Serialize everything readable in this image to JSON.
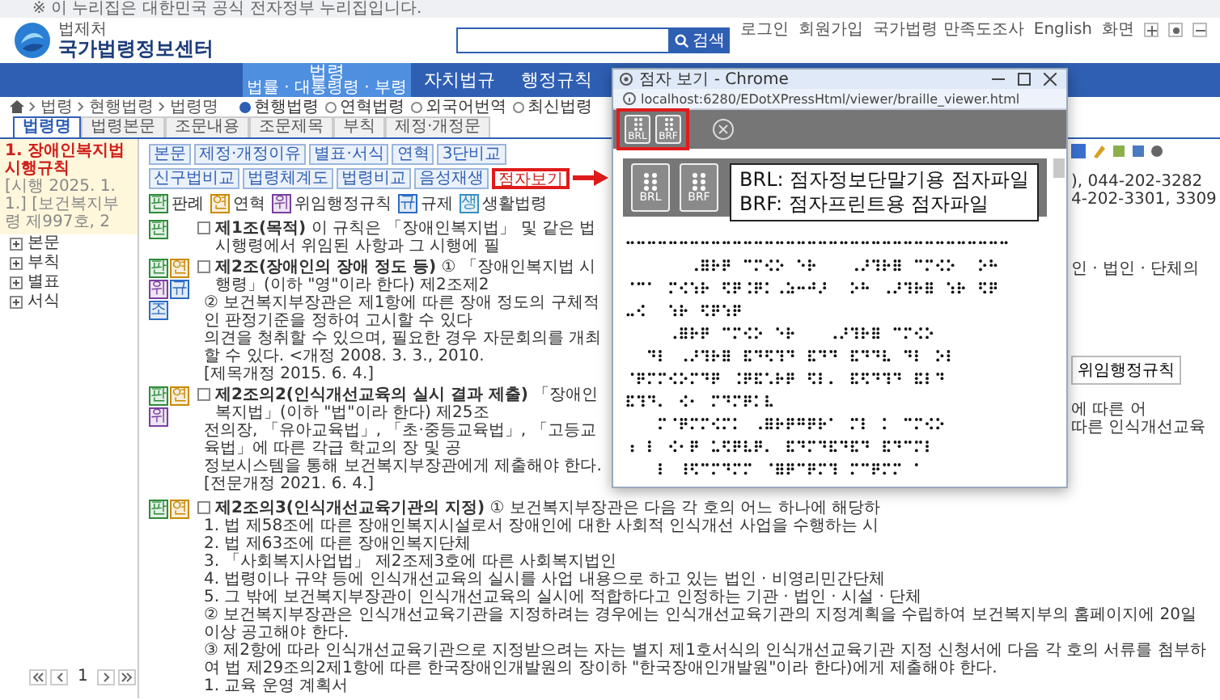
{
  "notice_bar": {
    "text": "※ 이 누리집은 대한민국 공식 전자정부 누리집입니다."
  },
  "header": {
    "logo": {
      "org": "법제처",
      "name": "국가법령정보센터"
    },
    "links": [
      "로그인",
      "회원가입",
      "국가법령 만족도조사",
      "English"
    ],
    "zoom_label": "화면",
    "search": {
      "button": "검색"
    }
  },
  "nav": [
    {
      "label": "법령",
      "sub": "법률 · 대통령령 · 부령",
      "selected": true
    },
    {
      "label": "자치법규",
      "selected": false
    },
    {
      "label": "행정규칙",
      "selected": false
    }
  ],
  "breadcrumb": [
    "법령",
    "현행법령",
    "법령명"
  ],
  "scope_options": [
    {
      "label": "현행법령",
      "selected": true
    },
    {
      "label": "연혁법령",
      "selected": false
    },
    {
      "label": "외국어번역",
      "selected": false
    },
    {
      "label": "최신법령",
      "selected": false
    }
  ],
  "tabs": [
    {
      "label": "법령명",
      "selected": true
    },
    {
      "label": "법령본문",
      "selected": false
    },
    {
      "label": "조문내용",
      "selected": false
    },
    {
      "label": "조문제목",
      "selected": false
    },
    {
      "label": "부칙",
      "selected": false
    },
    {
      "label": "제정·개정문",
      "selected": false
    }
  ],
  "sidebar": {
    "items": [
      {
        "title": "1. 장애인복지법 시행규칙",
        "detail": "[시행 2025. 1. 1.] [보건복지부령 제997호, 2",
        "selected": true
      }
    ],
    "tree": [
      "본문",
      "부칙",
      "별표",
      "서식"
    ],
    "pager": {
      "page": "1"
    }
  },
  "toolbar": [
    {
      "label": "본문",
      "highlighted": false
    },
    {
      "label": "제정·개정이유",
      "highlighted": false
    },
    {
      "label": "별표·서식",
      "highlighted": false
    },
    {
      "label": "연혁",
      "highlighted": false
    },
    {
      "label": "3단비교",
      "highlighted": false
    },
    {
      "label": "신구법비교",
      "highlighted": false
    },
    {
      "label": "법령체계도",
      "highlighted": false
    },
    {
      "label": "법령비교",
      "highlighted": false
    },
    {
      "label": "음성재생",
      "highlighted": false
    },
    {
      "label": "점자보기",
      "highlighted": true
    }
  ],
  "legend": [
    {
      "tag": "판",
      "label": "판례",
      "color": "#2e8b3a"
    },
    {
      "tag": "연",
      "label": "연혁",
      "color": "#c98a00"
    },
    {
      "tag": "위",
      "label": "위임행정규칙",
      "color": "#7a3fa0"
    },
    {
      "tag": "규",
      "label": "규제",
      "color": "#2a6cc4"
    },
    {
      "tag": "생",
      "label": "생활법령",
      "color": "#3a8fc0"
    }
  ],
  "articles": [
    {
      "tags": [
        {
          "label": "판",
          "color": "#2e8b3a"
        }
      ],
      "checked": false,
      "lines": [
        "**제1조(목적)** 이 규칙은 「장애인복지법」 및 같은 법 시행령에서 위임된 사항과 그 시행에 필"
      ]
    },
    {
      "tags": [
        {
          "label": "판",
          "color": "#2e8b3a"
        },
        {
          "label": "연",
          "color": "#c98a00"
        },
        {
          "label": "위",
          "color": "#7a3fa0"
        },
        {
          "label": "규",
          "color": "#2a6cc4"
        },
        {
          "label": "조",
          "color": "#2a6cc4"
        }
      ],
      "checked": false,
      "lines": [
        "**제2조(장애인의 장애 정도 등)** ① 「장애인복지법 시행령」(이하 \"영\"이라 한다) 제2조제2",
        "② 보건복지부장관은 제1항에 따른 장애 정도의 구체적인 판정기준을 정하여 고시할 수 있다",
        "의견을 청취할 수 있으며, 필요한 경우 자문회의를 개최할 수 있다. <개정 2008. 3. 3., 2010.",
        "[제목개정 2015. 6. 4.]"
      ]
    },
    {
      "tags": [
        {
          "label": "판",
          "color": "#2e8b3a"
        },
        {
          "label": "연",
          "color": "#c98a00"
        },
        {
          "label": "위",
          "color": "#7a3fa0"
        }
      ],
      "checked": false,
      "lines": [
        "**제2조의2(인식개선교육의 실시 결과 제출)** 「장애인복지법」(이하 \"법\"이라 한다) 제25조",
        "전의장, 「유아교육법」, 「초·중등교육법」, 「고등교육법」에 따른 각급 학교의 장 및 공",
        "정보시스템을 통해 보건복지부장관에게 제출해야 한다.",
        "[전문개정 2021. 6. 4.]"
      ]
    }
  ],
  "lower_article": {
    "tags": [
      {
        "label": "판",
        "color": "#2e8b3a"
      },
      {
        "label": "연",
        "color": "#c98a00"
      }
    ],
    "checked": false,
    "lines": [
      "**제2조의3(인식개선교육기관의 지정)** ① 보건복지부장관은 다음 각 호의 어느 하나에 해당하",
      "1. 법 제58조에 따른 장애인복지시설로서 장애인에 대한 사회적 인식개선 사업을 수행하는 시",
      "2. 법 제63조에 따른 장애인복지단체",
      "3. 「사회복지사업법」 제2조제3호에 따른 사회복지법인",
      "4. 법령이나 규약 등에 인식개선교육의 실시를 사업 내용으로 하고 있는 법인 · 비영리민간단체",
      "5. 그 밖에 보건복지부장관이 인식개선교육의 실시에 적합하다고 인정하는 기관 · 법인 · 시설 · 단체",
      "② 보건복지부장관은 인식개선교육기관을 지정하려는 경우에는 인식개선교육기관의 지정계획을 수립하여 보건복지부의 홈페이지에 20일 이상 공고해야 한다.",
      "③ 제2항에 따라 인식개선교육기관으로 지정받으려는 자는 별지 제1호서식의 인식개선교육기관 지정 신청서에 다음 각 호의 서류를 첨부하여 법 제29조의2제1항에 따른 한국장애인개발원의 장이하 \"한국장애인개발원\"이라 한다)에게 제출해야 한다.",
      "1. 교육 운영 계획서"
    ]
  },
  "right_strip": {
    "contact_lines": [
      "), 044-202-3282",
      "4-202-3301, 3309"
    ],
    "note": "인 · 법인 · 단체의",
    "button": "위임행정규칙",
    "tail_lines": [
      "에 따른 어",
      "따른 인식개선교육"
    ]
  },
  "popup": {
    "title": "점자 보기 - Chrome",
    "url": "localhost:6280/EDotXPressHtml/viewer/braille_viewer.html",
    "toolbar_buttons": [
      {
        "label": "BRL"
      },
      {
        "label": "BRF"
      }
    ],
    "panel_buttons": [
      {
        "label": "BRL"
      },
      {
        "label": "BRF"
      }
    ],
    "callout": [
      "BRL: 점자정보단말기용 점자파일",
      "BRF: 점자프린트용 점자파일"
    ]
  }
}
